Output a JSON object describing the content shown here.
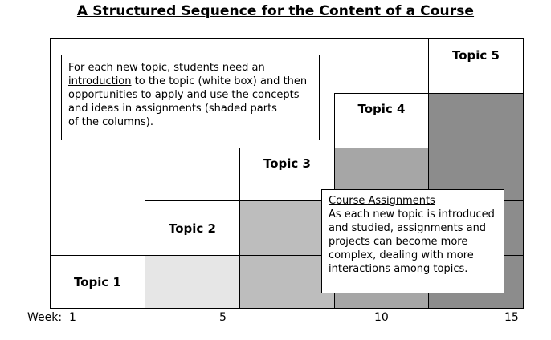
{
  "title": "A Structured Sequence for the Content of a Course",
  "topics": [
    "Topic 1",
    "Topic 2",
    "Topic 3",
    "Topic 4",
    "Topic 5"
  ],
  "intro_note": {
    "line1": "For each new topic, students need an",
    "underlined1": "introduction",
    "line2_rest": " to the topic (white box) and then",
    "line3_pre": "opportunities to ",
    "underlined2": "apply and use",
    "line3_post": " the concepts",
    "line4": "and ideas in assignments (shaded parts",
    "line5": "of the columns)."
  },
  "assign_note": {
    "heading": "Course Assignments",
    "line1": "As each new topic is introduced",
    "line2": "and studied, assignments and",
    "line3": "projects can become more",
    "line4": "complex, dealing with more",
    "line5": "interactions among topics."
  },
  "axis": {
    "label": "Week:",
    "ticks": [
      "1",
      "5",
      "10",
      "15"
    ]
  },
  "colors": {
    "shade1": "#e6e6e6",
    "shade2": "#bdbdbd",
    "shade3": "#a6a6a6",
    "shade4": "#8c8c8c"
  }
}
